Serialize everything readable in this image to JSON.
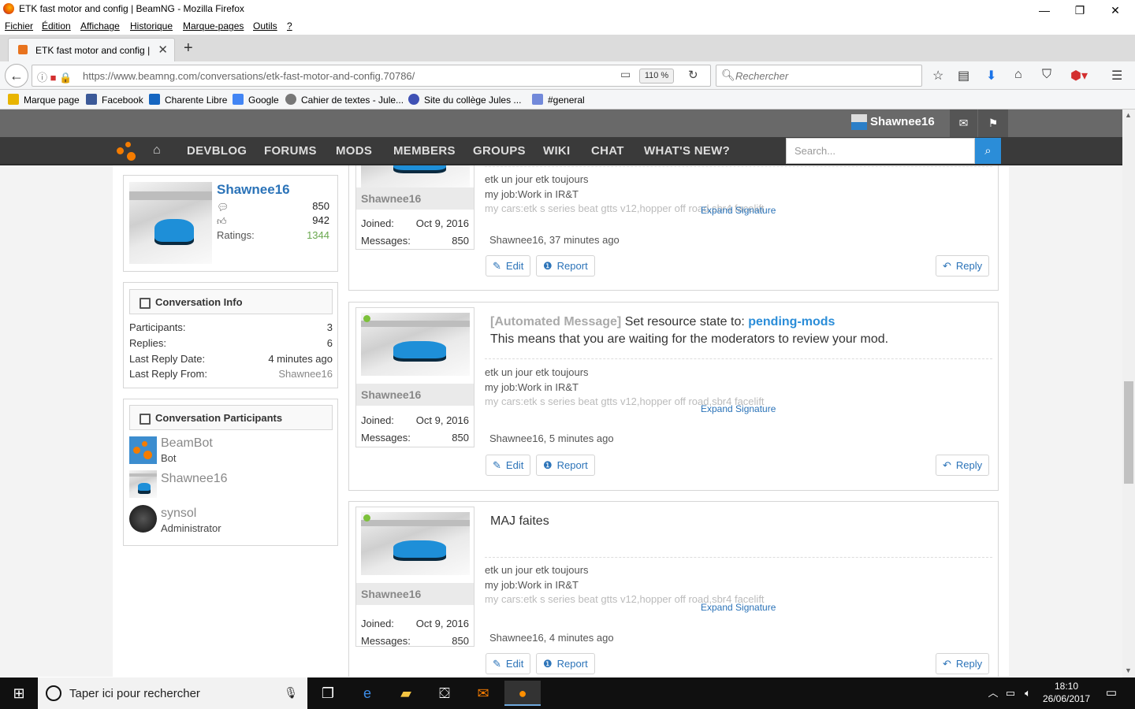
{
  "window": {
    "title": "ETK fast motor and config | BeamNG - Mozilla Firefox",
    "controls": {
      "minimize": "—",
      "maximize": "❐",
      "close": "✕"
    }
  },
  "menubar": [
    "Fichier",
    "Édition",
    "Affichage",
    "Historique",
    "Marque-pages",
    "Outils",
    "?"
  ],
  "tab": {
    "label": "ETK fast motor and config | ",
    "close": "✕",
    "new": "+"
  },
  "nav": {
    "url_host": "https://www.beamng.com",
    "url_path": "/conversations/etk-fast-motor-and-config.70786/",
    "zoom": "110 %",
    "search_placeholder": "Rechercher"
  },
  "bookmarks": [
    {
      "label": "Marque page",
      "color": "#e8b400"
    },
    {
      "label": "Facebook",
      "color": "#3b5998"
    },
    {
      "label": "Charente Libre",
      "color": "#1565c0"
    },
    {
      "label": "Google",
      "color": "#4285f4"
    },
    {
      "label": "Cahier de textes - Jule...",
      "color": "#777777"
    },
    {
      "label": "Site du collège Jules ...",
      "color": "#3f51b5"
    },
    {
      "label": "#general",
      "color": "#7289da"
    }
  ],
  "site": {
    "username": "Shawnee16",
    "nav_items": [
      "DEVBLOG",
      "FORUMS",
      "MODS",
      "MEMBERS",
      "GROUPS",
      "WIKI",
      "CHAT",
      "WHAT'S NEW?"
    ],
    "search_placeholder": "Search..."
  },
  "profile_card": {
    "name": "Shawnee16",
    "messages": "850",
    "likes": "942",
    "ratings_label": "Ratings:",
    "ratings": "1344"
  },
  "conversation_info": {
    "heading": "Conversation Info",
    "rows": [
      {
        "label": "Participants:",
        "value": "3"
      },
      {
        "label": "Replies:",
        "value": "6"
      },
      {
        "label": "Last Reply Date:",
        "value": "4 minutes ago"
      },
      {
        "label": "Last Reply From:",
        "value": "Shawnee16"
      }
    ]
  },
  "participants": {
    "heading": "Conversation Participants",
    "items": [
      {
        "name": "BeamBot",
        "role": "Bot"
      },
      {
        "name": "Shawnee16",
        "role": ""
      },
      {
        "name": "synsol",
        "role": "Administrator"
      }
    ]
  },
  "messages": [
    {
      "author": "Shawnee16",
      "joined_label": "Joined:",
      "joined": "Oct 9, 2016",
      "messages_label": "Messages:",
      "messages": "850",
      "body_tag": "",
      "body": "",
      "body_link": "",
      "body_line2": "",
      "signature": [
        "etk un jour etk toujours",
        "my job:Work in IR&T",
        "my cars:etk s series beat gtts v12,hopper off road,sbr4 facelift"
      ],
      "expand": "Expand Signature",
      "meta": "Shawnee16, 37 minutes ago",
      "edit": "Edit",
      "report": "Report",
      "reply": "Reply"
    },
    {
      "author": "Shawnee16",
      "joined_label": "Joined:",
      "joined": "Oct 9, 2016",
      "messages_label": "Messages:",
      "messages": "850",
      "body_tag": "[Automated Message]",
      "body": "Set resource state to:",
      "body_link": "pending-mods",
      "body_line2": "This means that you are waiting for the moderators to review your mod.",
      "signature": [
        "etk un jour etk toujours",
        "my job:Work in IR&T",
        "my cars:etk s series beat gtts v12,hopper off road,sbr4 facelift"
      ],
      "expand": "Expand Signature",
      "meta": "Shawnee16, 5 minutes ago",
      "edit": "Edit",
      "report": "Report",
      "reply": "Reply"
    },
    {
      "author": "Shawnee16",
      "joined_label": "Joined:",
      "joined": "Oct 9, 2016",
      "messages_label": "Messages:",
      "messages": "850",
      "body_tag": "",
      "body": "MAJ faites",
      "body_link": "",
      "body_line2": "",
      "signature": [
        "etk un jour etk toujours",
        "my job:Work in IR&T",
        "my cars:etk s series beat gtts v12,hopper off road,sbr4 facelift"
      ],
      "expand": "Expand Signature",
      "meta": "Shawnee16, 4 minutes ago",
      "edit": "Edit",
      "report": "Report",
      "reply": "Reply"
    }
  ],
  "taskbar": {
    "search_placeholder": "Taper ici pour rechercher",
    "time": "18:10",
    "date": "26/06/2017"
  },
  "colors": {
    "accent": "#2b8dd8",
    "nav_bg": "#3a3a3a",
    "header_bg": "#696969",
    "ratings": "#6aa84f"
  }
}
